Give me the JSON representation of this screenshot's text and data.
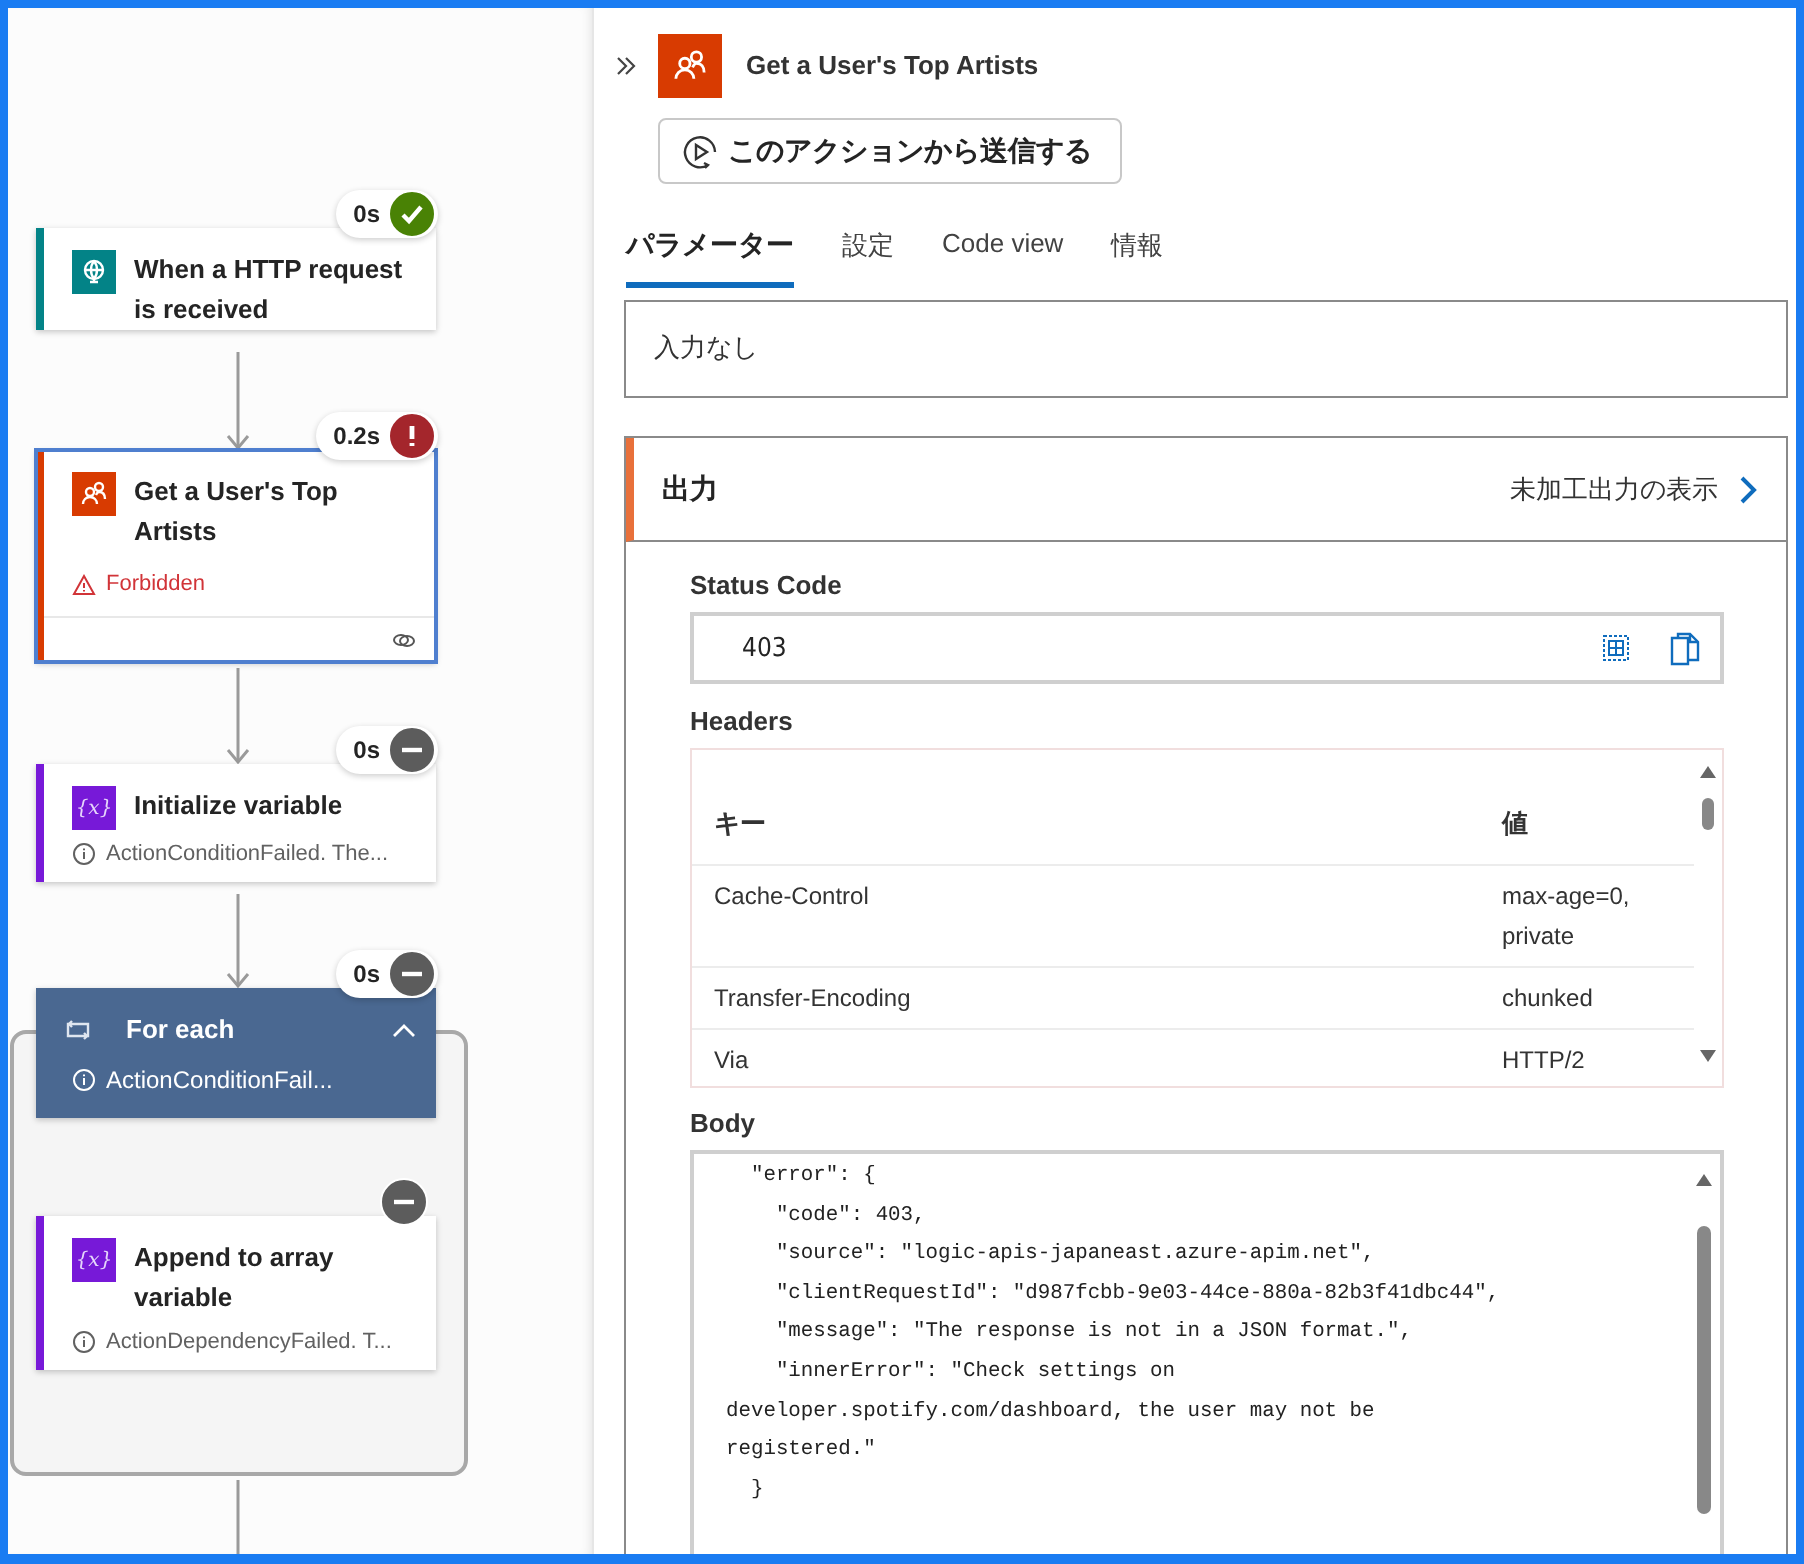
{
  "flow": {
    "nodes": [
      {
        "kind": "trigger",
        "title": "When a HTTP request is received",
        "badge": {
          "kind": "succeeded",
          "duration": "0s"
        },
        "selected": false,
        "color": "#038387"
      },
      {
        "kind": "action",
        "title": "Get a User's Top Artists",
        "badge": {
          "kind": "failed",
          "duration": "0.2s"
        },
        "selected": true,
        "color": "#d83b01",
        "message": "Forbidden"
      },
      {
        "kind": "variable",
        "icon": "{x}",
        "title": "Initialize variable",
        "badge": {
          "kind": "skipped",
          "duration": "0s"
        },
        "selected": false,
        "color": "#7719d8",
        "message": "ActionConditionFailed. The..."
      },
      {
        "kind": "foreach",
        "title": "For each",
        "badge": {
          "kind": "skipped",
          "duration": "0s"
        },
        "selected": false,
        "expanded": true,
        "message": "ActionConditionFail...",
        "children": [
          {
            "kind": "variable",
            "icon": "{x}",
            "title": "Append to array variable",
            "badge": {
              "kind": "skipped"
            },
            "selected": false,
            "color": "#7719d8",
            "message": "ActionDependencyFailed. T..."
          }
        ]
      }
    ]
  },
  "panel": {
    "title": "Get a User's Top Artists",
    "run_button": "このアクションから送信する",
    "tabs": [
      {
        "label": "パラメーター",
        "selected": true
      },
      {
        "label": "設定",
        "selected": false
      },
      {
        "label": "Code view",
        "selected": false
      },
      {
        "label": "情報",
        "selected": false
      }
    ],
    "input_section": {
      "text": "入力なし"
    },
    "output_section": {
      "title": "出力",
      "raw_link": "未加工出力の表示",
      "status_code": {
        "label": "Status Code",
        "value": "403"
      },
      "headers": {
        "label": "Headers",
        "columns": [
          "キー",
          "値"
        ],
        "rows": [
          [
            "Cache-Control",
            "max-age=0, private"
          ],
          [
            "Transfer-Encoding",
            "chunked"
          ],
          [
            "Via",
            "HTTP/2"
          ]
        ]
      },
      "body": {
        "label": "Body",
        "lines": [
          "  \"error\": {",
          "    \"code\": 403,",
          "    \"source\": \"logic-apis-japaneast.azure-apim.net\",",
          "    \"clientRequestId\": \"d987fcbb-9e03-44ce-880a-82b3f41dbc44\",",
          "    \"message\": \"The response is not in a JSON format.\",",
          "    \"innerError\": \"Check settings on",
          "developer.spotify.com/dashboard, the user may not be",
          "registered.\"",
          "  }"
        ]
      }
    }
  }
}
